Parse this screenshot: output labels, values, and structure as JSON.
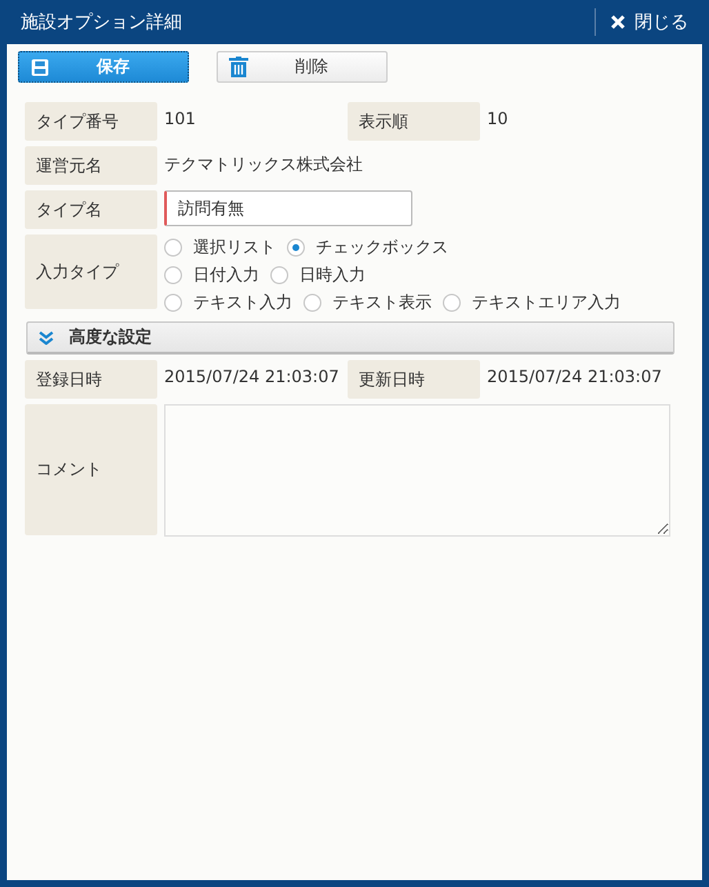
{
  "window": {
    "title": "施設オプション詳細",
    "close_label": "閉じる"
  },
  "toolbar": {
    "save": "保存",
    "delete": "削除"
  },
  "fields": {
    "type_number": {
      "label": "タイプ番号",
      "value": "101"
    },
    "display_order": {
      "label": "表示順",
      "value": "10"
    },
    "operator": {
      "label": "運営元名",
      "value": "テクマトリックス株式会社"
    },
    "type_name": {
      "label": "タイプ名",
      "value": "訪問有無",
      "required": true
    },
    "input_type": {
      "label": "入力タイプ",
      "option_rows": [
        [
          {
            "label": "選択リスト",
            "selected": false
          },
          {
            "label": "チェックボックス",
            "selected": true
          }
        ],
        [
          {
            "label": "日付入力",
            "selected": false
          },
          {
            "label": "日時入力",
            "selected": false
          }
        ],
        [
          {
            "label": "テキスト入力",
            "selected": false
          },
          {
            "label": "テキスト表示",
            "selected": false
          },
          {
            "label": "テキストエリア入力",
            "selected": false
          }
        ]
      ]
    }
  },
  "advanced": {
    "label": "高度な設定",
    "expanded": false
  },
  "dates": {
    "created": {
      "label": "登録日時",
      "value": "2015/07/24 21:03:07"
    },
    "updated": {
      "label": "更新日時",
      "value": "2015/07/24 21:03:07"
    }
  },
  "comment": {
    "label": "コメント"
  }
}
